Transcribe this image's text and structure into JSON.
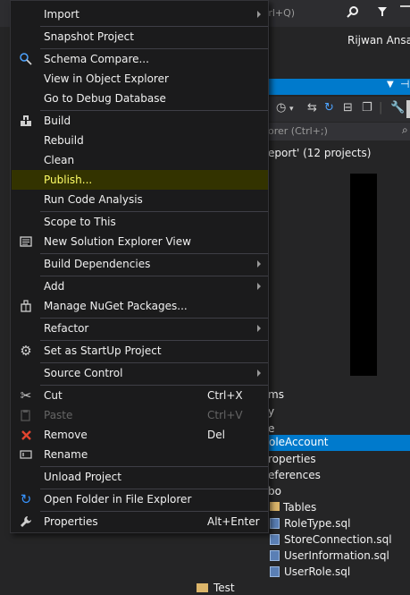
{
  "background": {
    "search_placeholder": "trl+Q)",
    "user_name": "Rijwan Ansar",
    "se_search_placeholder": "orer (Ctrl+;)",
    "solution_text": "eport' (12 projects)",
    "tree_items": [
      "ms",
      "y",
      "e"
    ],
    "selected_item": "oleAccount",
    "tree_items_after": [
      "roperties",
      "eferences",
      "bo",
      "Tables"
    ],
    "sql_files": [
      "RoleType.sql",
      "StoreConnection.sql",
      "UserInformation.sql",
      "UserRole.sql"
    ],
    "test_folder": "Test"
  },
  "menu": {
    "items": [
      {
        "label": "Import",
        "submenu": true
      },
      {
        "label": "Snapshot Project"
      },
      {
        "label": "Schema Compare...",
        "icon": "schema-compare-icon"
      },
      {
        "label": "View in Object Explorer"
      },
      {
        "label": "Go to Debug Database"
      },
      {
        "label": "Build",
        "icon": "build-icon"
      },
      {
        "label": "Rebuild"
      },
      {
        "label": "Clean"
      },
      {
        "label": "Publish...",
        "highlighted": true
      },
      {
        "label": "Run Code Analysis"
      },
      {
        "label": "Scope to This"
      },
      {
        "label": "New Solution Explorer View",
        "icon": "new-view-icon"
      },
      {
        "label": "Build Dependencies",
        "submenu": true
      },
      {
        "label": "Add",
        "submenu": true
      },
      {
        "label": "Manage NuGet Packages...",
        "icon": "nuget-icon"
      },
      {
        "label": "Refactor",
        "submenu": true
      },
      {
        "label": "Set as StartUp Project",
        "icon": "gear-icon"
      },
      {
        "label": "Source Control",
        "submenu": true
      },
      {
        "label": "Cut",
        "shortcut": "Ctrl+X",
        "icon": "scissors-icon"
      },
      {
        "label": "Paste",
        "shortcut": "Ctrl+V",
        "icon": "paste-icon",
        "disabled": true
      },
      {
        "label": "Remove",
        "shortcut": "Del",
        "icon": "remove-icon"
      },
      {
        "label": "Rename",
        "icon": "rename-icon"
      },
      {
        "label": "Unload Project"
      },
      {
        "label": "Open Folder in File Explorer",
        "icon": "refresh-folder-icon"
      },
      {
        "label": "Properties",
        "shortcut": "Alt+Enter",
        "icon": "wrench-icon"
      }
    ]
  },
  "colors": {
    "accent": "#007acc",
    "highlight_text": "#ffff66",
    "remove_icon": "#e2452f",
    "open_folder_icon": "#3794ff"
  }
}
